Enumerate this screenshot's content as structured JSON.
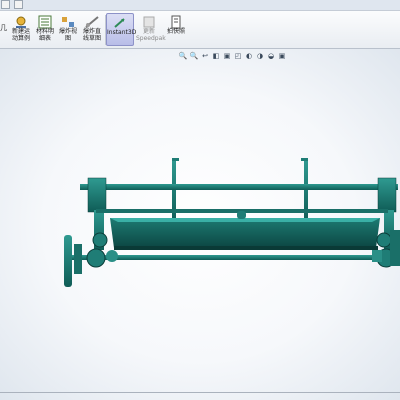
{
  "ribbon": {
    "items": [
      {
        "label": "新建运\n动算例",
        "icon": "motion-study-icon"
      },
      {
        "label": "材料明\n细表",
        "icon": "bill-of-materials-icon"
      },
      {
        "label": "爆炸视\n图",
        "icon": "exploded-view-icon"
      },
      {
        "label": "爆炸直\n线草图",
        "icon": "explode-line-sketch-icon"
      },
      {
        "label": "Instant3D",
        "icon": "instant3d-icon",
        "active": true
      },
      {
        "label": "更新\nSpeedpak",
        "icon": "update-speedpak-icon",
        "disabled": true
      },
      {
        "label": "拍快照",
        "icon": "take-snapshot-icon"
      }
    ],
    "left_edge_label": "几"
  },
  "headsup": {
    "icons": [
      "zoom-to-fit-icon",
      "zoom-to-area-icon",
      "previous-view-icon",
      "section-view-icon",
      "view-orientation-icon",
      "display-style-icon",
      "hide-show-items-icon",
      "edit-appearance-icon",
      "apply-scene-icon",
      "view-settings-icon"
    ],
    "glyphs": [
      "🔍",
      "🔍",
      "↩",
      "◧",
      "▣",
      "◰",
      "◐",
      "◑",
      "◒",
      "▣"
    ]
  },
  "colors": {
    "model_teal": "#1f7d76",
    "model_dark": "#0f4f4a",
    "active_button": "#b8bde8"
  }
}
